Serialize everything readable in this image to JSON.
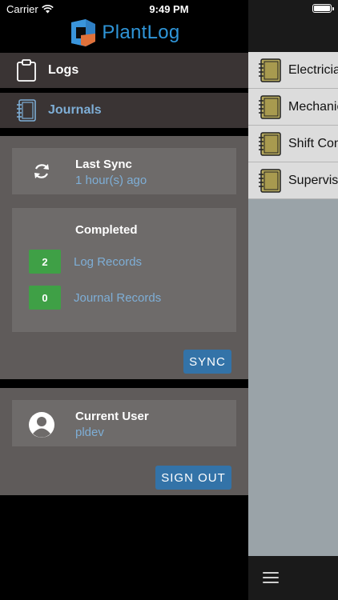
{
  "status_bar": {
    "carrier": "Carrier",
    "time": "9:49 PM",
    "wifi_icon": "wifi-icon",
    "battery_icon": "battery-icon"
  },
  "app": {
    "name": "PlantLog",
    "brand_color": "#2f95d8"
  },
  "nav": {
    "logs_label": "Logs",
    "journals_label": "Journals",
    "logs_icon": "clipboard-icon",
    "journals_icon": "notebook-icon"
  },
  "sync": {
    "last_sync_title": "Last Sync",
    "last_sync_value": "1 hour(s) ago",
    "completed_title": "Completed",
    "log_records_count": "2",
    "log_records_label": "Log Records",
    "journal_records_count": "0",
    "journal_records_label": "Journal Records",
    "sync_button": "SYNC",
    "badge_color": "#3fa046",
    "button_color": "#3373a8"
  },
  "user": {
    "title": "Current User",
    "name": "pldev",
    "sign_out_button": "SIGN OUT"
  },
  "journals": [
    {
      "name": "Electricia"
    },
    {
      "name": "Mechanic"
    },
    {
      "name": "Shift Con"
    },
    {
      "name": "Supervis"
    }
  ],
  "bottom_bar": {
    "menu_icon": "hamburger-menu-icon"
  }
}
